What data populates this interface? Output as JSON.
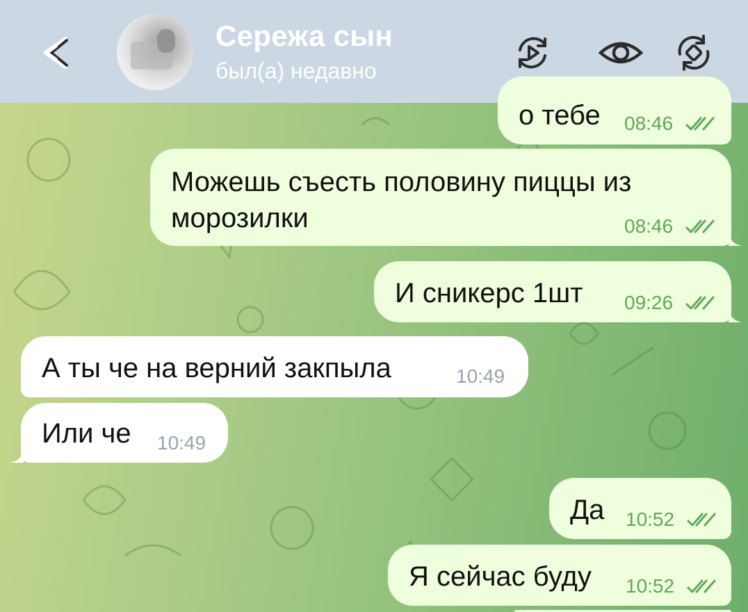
{
  "header": {
    "contact_name": "Сережа сын",
    "contact_status": "был(а) недавно"
  },
  "icons": {
    "back": "back-arrow-icon",
    "video_call": "video-call-icon",
    "view_once": "eye-icon",
    "rotate": "rotate-icon"
  },
  "colors": {
    "header_bg": "#cbd8e3",
    "outgoing_bubble": "#effedd",
    "incoming_bubble": "#ffffff",
    "outgoing_time": "#5fa85b",
    "check_color": "#5fa85b"
  },
  "messages": [
    {
      "direction": "out",
      "text": "о тебе",
      "time": "08:46",
      "read": true
    },
    {
      "direction": "out",
      "text_line1": "Можешь съесть половину пиццы из",
      "text_line2": "морозилки",
      "time": "08:46",
      "read": true
    },
    {
      "direction": "out",
      "text": "И сникерс 1шт",
      "time": "09:26",
      "read": true
    },
    {
      "direction": "in",
      "text": "А ты че на верний закпыла",
      "time": "10:49"
    },
    {
      "direction": "in",
      "text": "Или че",
      "time": "10:49"
    },
    {
      "direction": "out",
      "text": "Да",
      "time": "10:52",
      "read": true
    },
    {
      "direction": "out",
      "text": "Я сейчас буду",
      "time": "10:52",
      "read": true
    }
  ]
}
